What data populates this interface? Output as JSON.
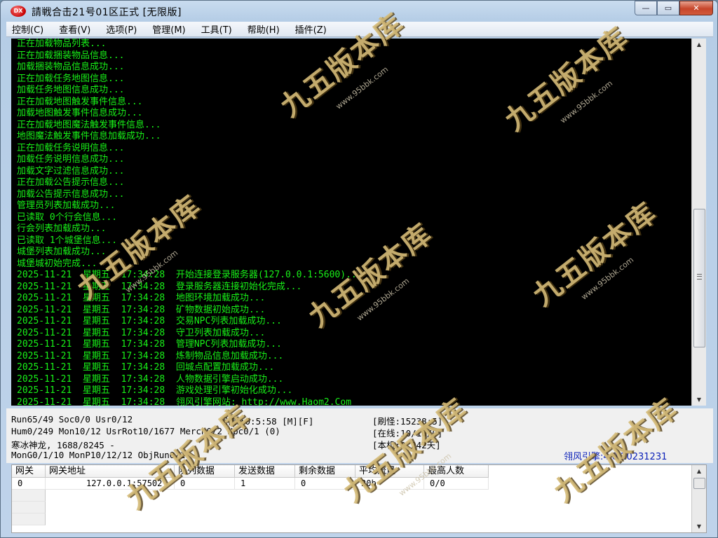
{
  "window": {
    "icon_text": "DX",
    "title": "請戦合击21号01区正式 [无限版]",
    "minimize_glyph": "—",
    "maximize_glyph": "▭",
    "close_glyph": "✕"
  },
  "menu": [
    {
      "label": "控制(C)"
    },
    {
      "label": "查看(V)"
    },
    {
      "label": "选项(P)"
    },
    {
      "label": "管理(M)"
    },
    {
      "label": "工具(T)"
    },
    {
      "label": "帮助(H)"
    },
    {
      "label": "插件(Z)"
    }
  ],
  "log": {
    "text_color": "#18f018",
    "background": "#000000",
    "lines": [
      "正在加载物品列表...",
      "正在加载捆装物品信息...",
      "加载捆装物品信息成功...",
      "正在加载任务地图信息...",
      "加载任务地图信息成功...",
      "正在加载地图触发事件信息...",
      "加载地图触发事件信息成功...",
      "正在加载地图魔法触发事件信息...",
      "地图魔法触发事件信息加载成功...",
      "正在加载任务说明信息...",
      "加载任务说明信息成功...",
      "加载文字过滤信息成功...",
      "正在加载公告提示信息...",
      "加载公告提示信息成功...",
      "管理员列表加载成功...",
      "已读取 0个行会信息...",
      "行会列表加载成功...",
      "已读取 1个城堡信息...",
      "城堡列表加载成功...",
      "城堡城初始完成...",
      "2025-11-21  星期五  17:34:28  开始连接登录服务器(127.0.0.1:5600)...",
      "2025-11-21  星期五  17:34:28  登录服务器连接初始化完成...",
      "2025-11-21  星期五  17:34:28  地图环境加载成功...",
      "2025-11-21  星期五  17:34:28  矿物数据初始成功...",
      "2025-11-21  星期五  17:34:28  交易NPC列表加载成功...",
      "2025-11-21  星期五  17:34:28  守卫列表加载成功...",
      "2025-11-21  星期五  17:34:28  管理NPC列表加载成功...",
      "2025-11-21  星期五  17:34:28  炼制物品信息加载成功...",
      "2025-11-21  星期五  17:34:28  回城点配置加载成功...",
      "2025-11-21  星期五  17:34:28  人物数据引擎启动成功...",
      "2025-11-21  星期五  17:34:28  游戏处理引擎初始化成功...",
      "2025-11-21  星期五  17:34:28  翎风引擎网站: http://www.Haom2.Com"
    ]
  },
  "scrollbar": {
    "up": "▲",
    "down": "▼"
  },
  "status": {
    "line1": "Run65/49 Soc0/0 Usr0/12",
    "engine": "引擎:0:5:58 [M][F]",
    "refresh": "[刷怪:15238:5]",
    "line2": "Hum0/249 Mon10/12 UsrRot10/1677 Merch0/2 Npc0/1 (0)",
    "online": "[在线:10/10/0]",
    "line3": "寒冰神龙, 1688/8245 -",
    "machine": "[本机:0.242天]",
    "line4": "MonG0/1/10 MonP10/12/12 ObjRun0/1",
    "version": "翎风引擎:4.0 20231231"
  },
  "grid": {
    "headers": [
      "网关",
      "网关地址",
      "队列数据",
      "发送数据",
      "剩余数据",
      "平均流量",
      "最高人数"
    ],
    "rows": [
      [
        "0",
        "127.0.0.1:57502",
        "0",
        "1",
        "0",
        "20b",
        "0/0"
      ]
    ]
  },
  "watermark": {
    "brand": "九五版本库",
    "url": "www.95bbk.com"
  }
}
